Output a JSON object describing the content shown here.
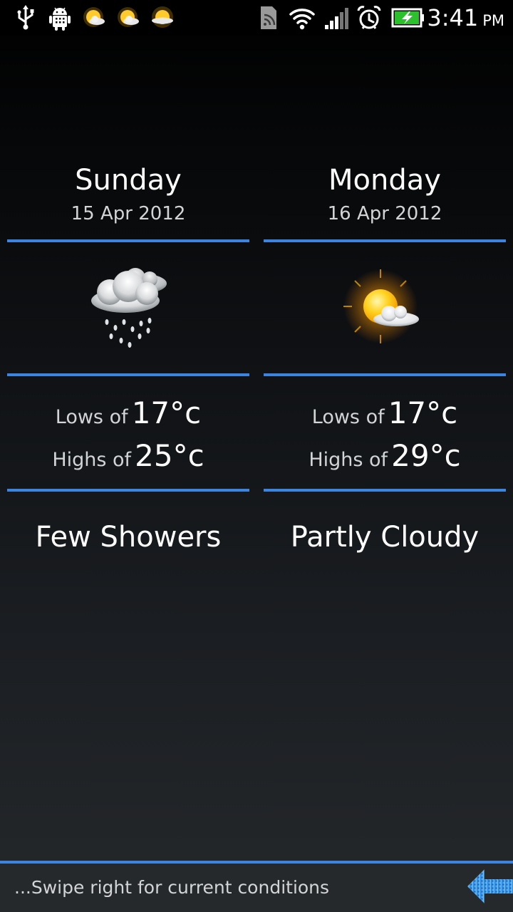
{
  "status_bar": {
    "left_icons": [
      "usb-icon",
      "android-debug-icon",
      "weather-notification-icon",
      "weather-notification-icon",
      "weather-notification-icon"
    ],
    "right_icons": [
      "sim-card-icon",
      "wifi-icon",
      "signal-icon",
      "alarm-icon",
      "battery-charging-icon"
    ],
    "time": "3:41",
    "ampm": "PM"
  },
  "forecast": [
    {
      "day": "Sunday",
      "date": "15 Apr 2012",
      "icon": "few-showers-icon",
      "lows_label": "Lows of",
      "lows_value": "17°c",
      "highs_label": "Highs of",
      "highs_value": "25°c",
      "condition": "Few Showers"
    },
    {
      "day": "Monday",
      "date": "16 Apr 2012",
      "icon": "partly-cloudy-icon",
      "lows_label": "Lows of",
      "lows_value": "17°c",
      "highs_label": "Highs of",
      "highs_value": "29°c",
      "condition": "Partly Cloudy"
    }
  ],
  "footer": {
    "hint": "...Swipe right for current conditions",
    "arrow_icon": "swipe-arrow-icon"
  },
  "colors": {
    "accent": "#3b84e0",
    "text": "#ffffff",
    "secondary_text": "#d2d4d6"
  }
}
